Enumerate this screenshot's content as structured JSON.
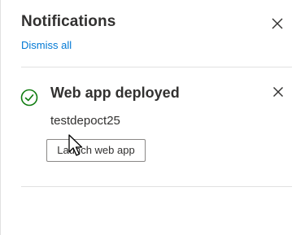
{
  "panel": {
    "title": "Notifications",
    "dismiss_all_label": "Dismiss all",
    "close_icon": "close-icon"
  },
  "notification": {
    "status_icon": "success-check-icon",
    "title": "Web app deployed",
    "body": "testdepoct25",
    "action_label": "Launch web app",
    "close_icon": "close-icon"
  },
  "colors": {
    "link": "#0078d4",
    "success": "#107c10",
    "text": "#323130",
    "divider": "#e1e1e1"
  }
}
